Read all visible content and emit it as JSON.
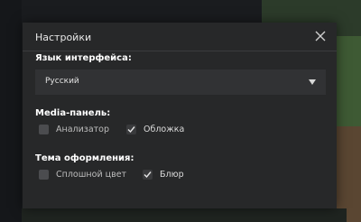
{
  "dialog": {
    "title": "Настройки",
    "close_icon": "close-icon"
  },
  "language": {
    "label": "Язык интерфейса:",
    "selected": "Русский"
  },
  "media_panel": {
    "label": "Media-панель:",
    "options": [
      {
        "label": "Анализатор",
        "checked": false
      },
      {
        "label": "Обложка",
        "checked": true
      }
    ]
  },
  "theme": {
    "label": "Тема оформления:",
    "options": [
      {
        "label": "Сплошной цвет",
        "checked": false
      },
      {
        "label": "Блюр",
        "checked": true
      }
    ]
  },
  "colors": {
    "dialog_bg": "#272829",
    "accent_bg_green": "#3f5a34"
  }
}
